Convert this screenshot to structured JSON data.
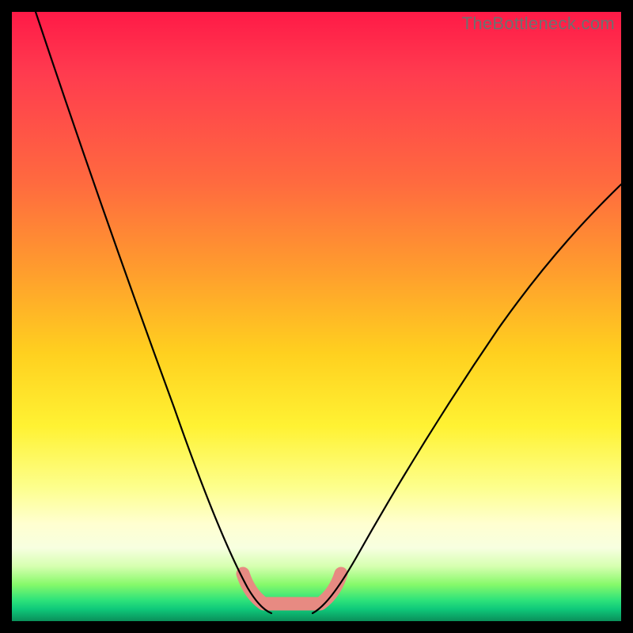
{
  "watermark": "TheBottleneck.com",
  "chart_data": {
    "type": "line",
    "title": "",
    "xlabel": "",
    "ylabel": "",
    "xlim": [
      0,
      100
    ],
    "ylim": [
      0,
      100
    ],
    "grid": false,
    "legend": false,
    "series": [
      {
        "name": "left-curve",
        "x": [
          4,
          10,
          16,
          22,
          26,
          30,
          33,
          35.5,
          37.5,
          39.5,
          41
        ],
        "values": [
          100,
          85,
          68,
          50,
          36,
          24,
          14,
          8,
          4,
          1.5,
          0.2
        ]
      },
      {
        "name": "right-curve",
        "x": [
          49,
          52,
          56,
          62,
          70,
          80,
          90,
          100
        ],
        "values": [
          0.2,
          3,
          9,
          20,
          35,
          52,
          64,
          72
        ]
      },
      {
        "name": "floor-highlight",
        "x": [
          38,
          40,
          42,
          44,
          46,
          48,
          50,
          52
        ],
        "values": [
          5,
          1.5,
          0.3,
          0.2,
          0.2,
          0.3,
          1.5,
          5
        ]
      }
    ],
    "colors": {
      "curve": "#000000",
      "highlight": "#e78a82",
      "gradient_top": "#ff1a47",
      "gradient_mid": "#fff233",
      "gradient_bottom": "#0fc97a"
    }
  }
}
